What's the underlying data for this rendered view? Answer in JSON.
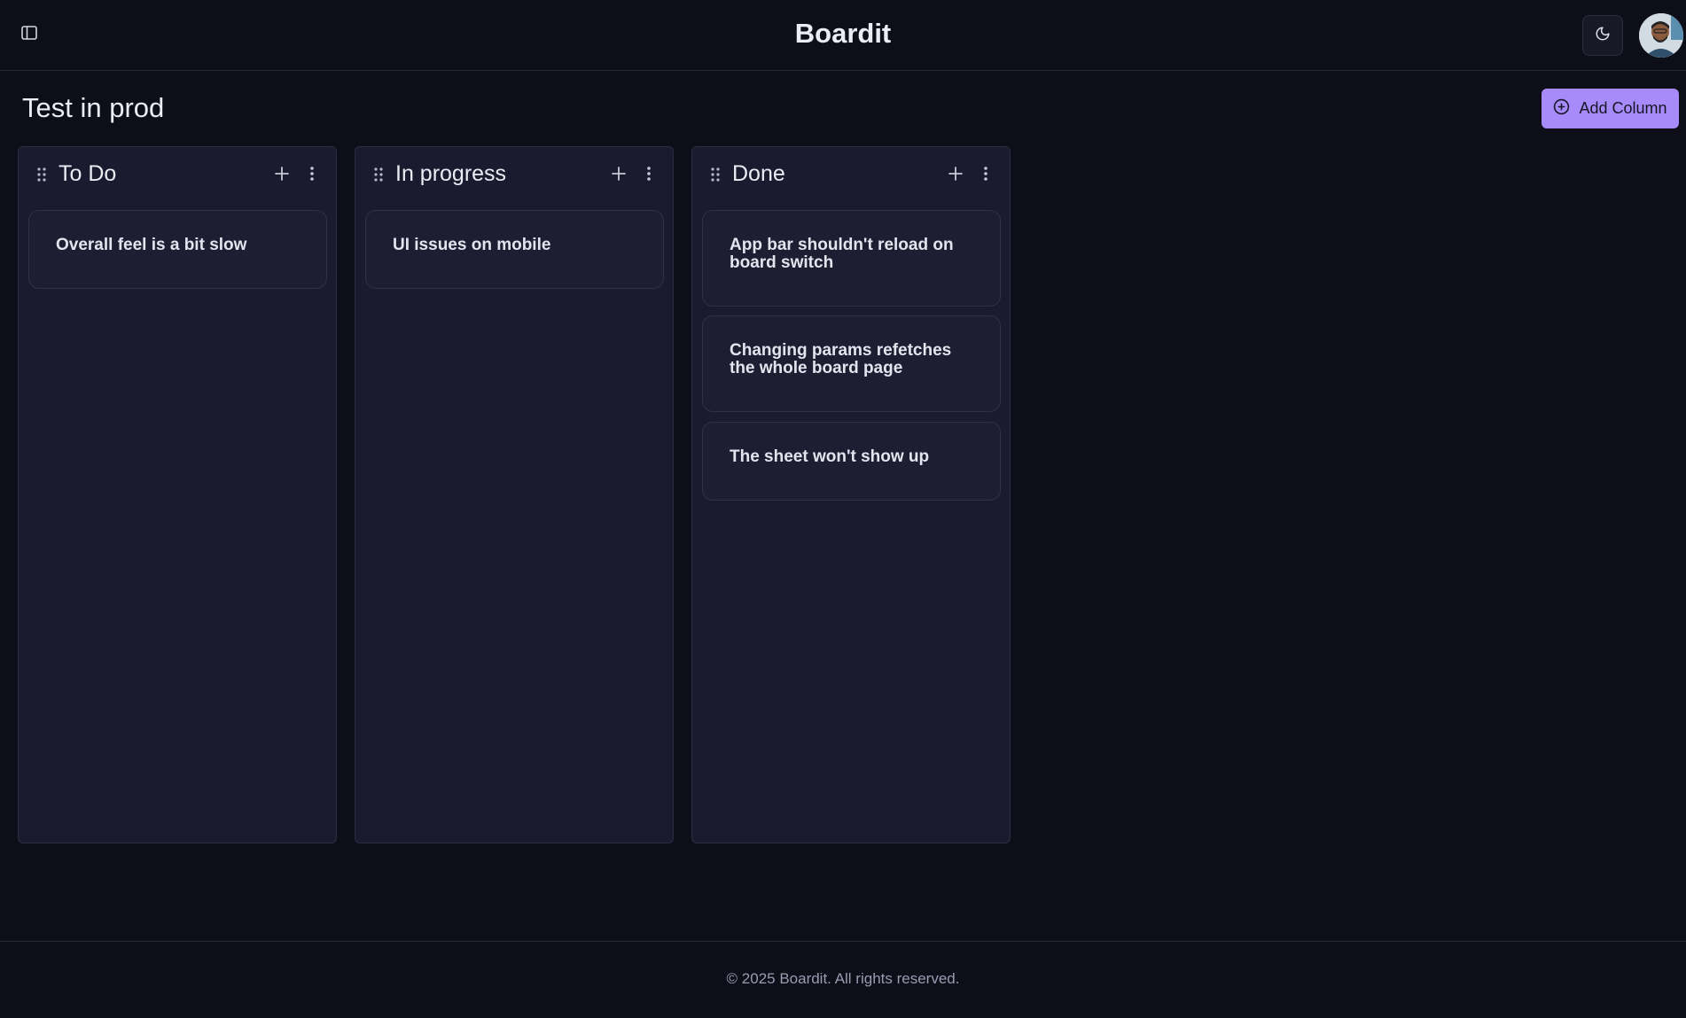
{
  "header": {
    "title": "Boardit",
    "sidebar_toggle_icon": "sidebar-toggle-icon",
    "theme_icon": "moon-icon",
    "avatar": "user-avatar"
  },
  "page": {
    "title": "Test in prod",
    "add_column_label": "Add Column",
    "add_column_icon": "plus-circle-icon"
  },
  "columns": [
    {
      "title": "To Do",
      "cards": [
        {
          "title": "Overall feel is a bit slow"
        }
      ]
    },
    {
      "title": "In progress",
      "cards": [
        {
          "title": "UI issues on mobile"
        }
      ]
    },
    {
      "title": "Done",
      "cards": [
        {
          "title": "App bar shouldn't reload on board switch"
        },
        {
          "title": "Changing params refetches the whole board page"
        },
        {
          "title": "The sheet won't show up"
        }
      ]
    }
  ],
  "footer": {
    "text": "© 2025 Boardit. All rights reserved."
  },
  "colors": {
    "background": "#0e0e19",
    "column_bg": "#1a1b2e",
    "accent": "#a78bfa"
  }
}
